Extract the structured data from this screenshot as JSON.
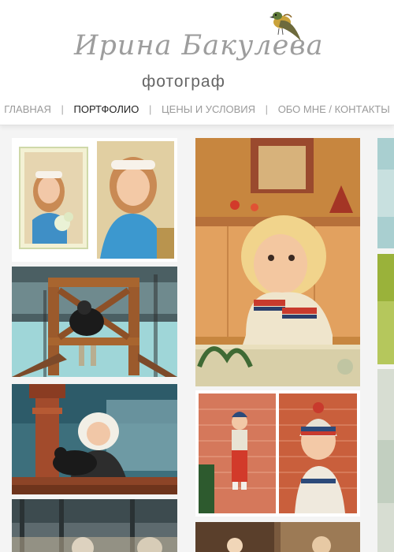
{
  "logo": {
    "title": "Ирина Бакулева",
    "subtitle": "фотограф",
    "icon": "bird-icon"
  },
  "nav": {
    "items": [
      {
        "label": "ГЛАВНАЯ",
        "active": false
      },
      {
        "label": "ПОРТФОЛИО",
        "active": true
      },
      {
        "label": "ЦЕНЫ И УСЛОВИЯ",
        "active": false
      },
      {
        "label": "ОБО МНЕ / КОНТАКТЫ",
        "active": false
      }
    ],
    "separator": "|"
  },
  "gallery": {
    "photos": [
      {
        "subject": "girl with white headband holding flowers (diptych)"
      },
      {
        "subject": "child on wooden swing in snow"
      },
      {
        "subject": "child in knitted sweater leaning on table"
      },
      {
        "subject": "child in white hood with black dog"
      },
      {
        "subject": "child in knit hat by brick wall (diptych)"
      }
    ]
  },
  "colors": {
    "header_bg": "#ffffff",
    "page_bg": "#f4f4f4",
    "nav_active": "#222222",
    "nav_inactive": "#9a9a9a"
  }
}
